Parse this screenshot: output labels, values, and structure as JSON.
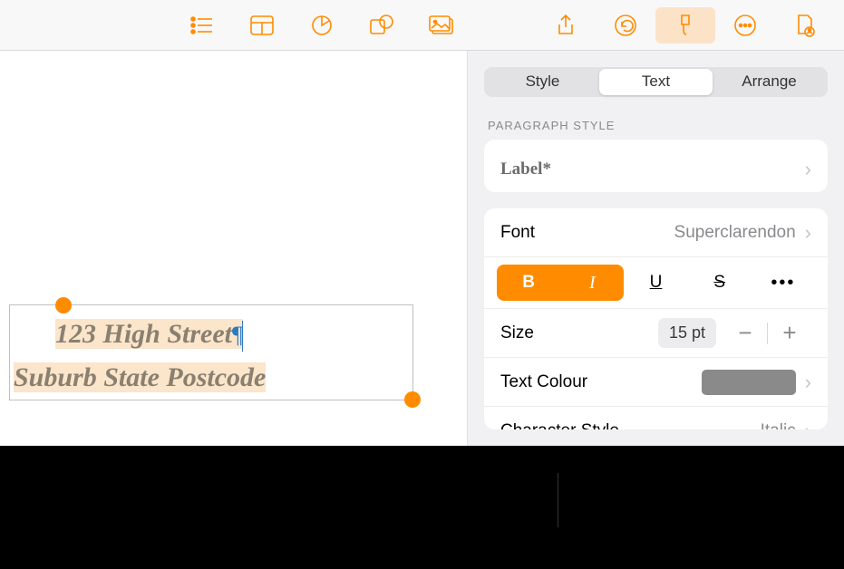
{
  "toolbar_icons": [
    "list",
    "table",
    "chart",
    "shape",
    "media",
    "share",
    "undo",
    "format",
    "more",
    "collab"
  ],
  "canvas": {
    "line1": "123 High Street",
    "line2": "Suburb State Postcode",
    "paragraph_mark": "¶"
  },
  "inspector": {
    "tabs": {
      "style": "Style",
      "text": "Text",
      "arrange": "Arrange"
    },
    "paragraph_style_header": "PARAGRAPH STYLE",
    "paragraph_style_value": "Label*",
    "font_label": "Font",
    "font_value": "Superclarendon",
    "style_buttons": {
      "bold": "B",
      "italic": "I",
      "underline": "U",
      "strike": "S",
      "more": "•••"
    },
    "size_label": "Size",
    "size_value": "15 pt",
    "stepper_minus": "−",
    "stepper_plus": "+",
    "text_colour_label": "Text Colour",
    "char_style_label": "Character Style",
    "char_style_value": "Italic",
    "chevron": "›"
  },
  "colors": {
    "accent": "#ff8c00",
    "swatch": "#8a8a8a"
  }
}
